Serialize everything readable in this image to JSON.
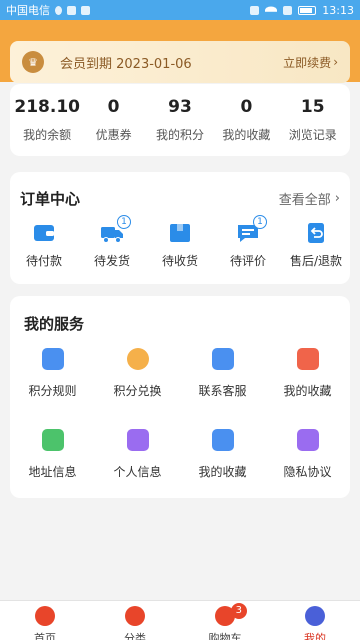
{
  "status_bar": {
    "carrier": "中国电信",
    "time": "13:13"
  },
  "vip": {
    "expire_text": "会员到期 2023-01-06",
    "renew_label": "立即续费",
    "renew_arrow": "›"
  },
  "stats": [
    {
      "value": "218.10",
      "label": "我的余额"
    },
    {
      "value": "0",
      "label": "优惠券"
    },
    {
      "value": "93",
      "label": "我的积分"
    },
    {
      "value": "0",
      "label": "我的收藏"
    },
    {
      "value": "15",
      "label": "浏览记录"
    }
  ],
  "orders": {
    "title": "订单中心",
    "view_all": "查看全部",
    "view_all_arrow": "›",
    "items": [
      {
        "label": "待付款",
        "icon": "wallet-icon",
        "badge": null
      },
      {
        "label": "待发货",
        "icon": "truck-icon",
        "badge": "1"
      },
      {
        "label": "待收货",
        "icon": "package-icon",
        "badge": null
      },
      {
        "label": "待评价",
        "icon": "comment-icon",
        "badge": "1"
      },
      {
        "label": "售后/退款",
        "icon": "refund-icon",
        "badge": null
      }
    ]
  },
  "services": {
    "title": "我的服务",
    "items": [
      {
        "label": "积分规则",
        "icon": "points-rules-icon",
        "color": "#4a90f0"
      },
      {
        "label": "积分兑换",
        "icon": "points-exchange-icon",
        "color": "#f5b04a"
      },
      {
        "label": "联系客服",
        "icon": "customer-service-icon",
        "color": "#4a90f0"
      },
      {
        "label": "我的收藏",
        "icon": "favorite-icon",
        "color": "#f0644a"
      },
      {
        "label": "地址信息",
        "icon": "address-icon",
        "color": "#4cc36b"
      },
      {
        "label": "个人信息",
        "icon": "profile-icon",
        "color": "#9a6cf0"
      },
      {
        "label": "我的收藏",
        "icon": "collection-icon",
        "color": "#4a90f0"
      },
      {
        "label": "隐私协议",
        "icon": "privacy-lock-icon",
        "color": "#9a6cf0"
      }
    ]
  },
  "tabbar": {
    "tabs": [
      {
        "label": "首页",
        "icon": "home-icon",
        "color": "#e8452a"
      },
      {
        "label": "分类",
        "icon": "category-icon",
        "color": "#e8452a"
      },
      {
        "label": "购物车",
        "icon": "cart-icon",
        "color": "#e8452a",
        "badge": "3"
      },
      {
        "label": "我的",
        "icon": "profile-tab-icon",
        "color": "#4a60d8",
        "active": true
      }
    ]
  },
  "colors": {
    "accent": "#2b8ce8",
    "header": "#f4a63f",
    "active_tab": "#d9321f"
  }
}
